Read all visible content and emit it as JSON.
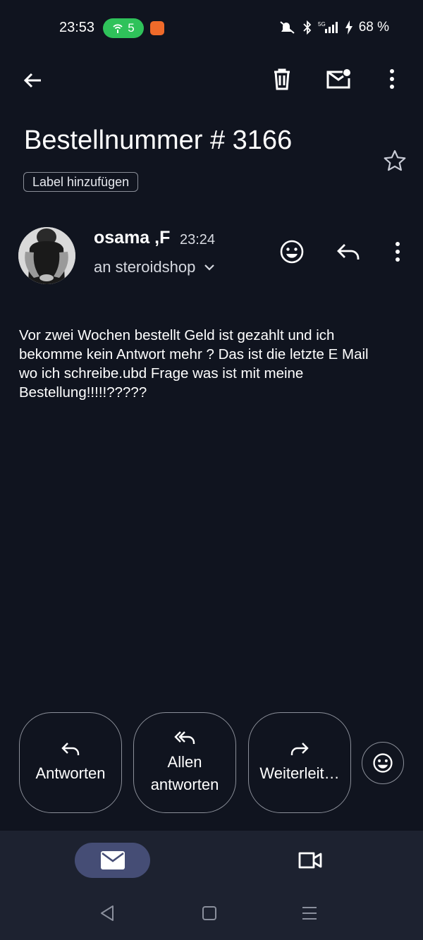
{
  "status_bar": {
    "time": "23:53",
    "hotspot_count": "5",
    "battery": "68 %",
    "icons": [
      "wifi-hotspot-icon",
      "app-notification-icon",
      "mute-icon",
      "bluetooth-icon",
      "5g-signal-icon",
      "charging-icon"
    ]
  },
  "toolbar": {
    "icons": [
      "back-arrow-icon",
      "trash-icon",
      "mark-unread-icon",
      "more-vert-icon"
    ]
  },
  "email": {
    "subject": "Bestellnummer # 3166",
    "label_chip": "Label hinzufügen",
    "sender": "osama ,F",
    "time": "23:24",
    "recipient": "an steroidshop",
    "body": "Vor zwei Wochen bestellt Geld ist gezahlt und ich bekomme kein Antwort mehr ? Das ist die letzte E Mail wo ich schreibe.ubd Frage was ist mit meine Bestellung!!!!!?????"
  },
  "actions": {
    "reply": "Antworten",
    "reply_all_line1": "Allen",
    "reply_all_line2": "antworten",
    "forward": "Weiterleit…"
  },
  "colors": {
    "background": "#10141f",
    "bottom_nav": "#1d2230",
    "nav_active": "#454d75",
    "hotspot_green": "#2fc25a"
  }
}
